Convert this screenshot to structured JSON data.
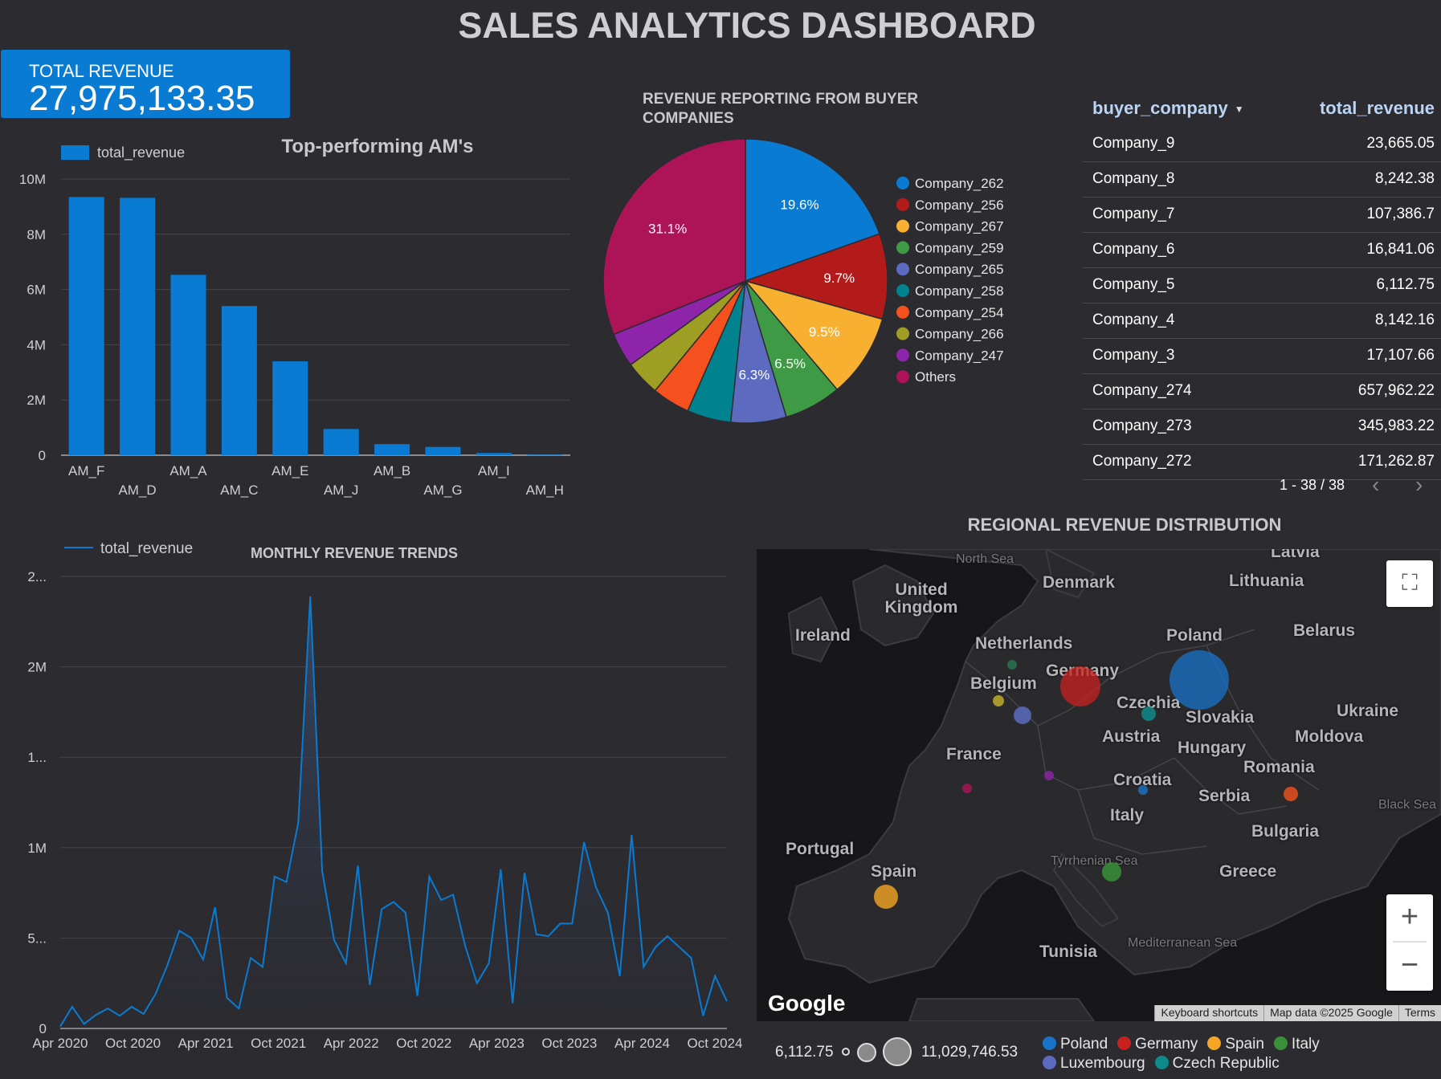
{
  "header": {
    "title": "SALES ANALYTICS DASHBOARD"
  },
  "kpi": {
    "label": "TOTAL REVENUE",
    "value": "27,975,133.35"
  },
  "am_chart": {
    "title": "Top-performing AM's",
    "legend": "total_revenue",
    "color": "#0a7bd3"
  },
  "pie_chart": {
    "title_line1": "REVENUE REPORTING FROM BUYER",
    "title_line2": "COMPANIES"
  },
  "table": {
    "col1": "buyer_company",
    "col2": "total_revenue",
    "rows": [
      {
        "company": "Company_9",
        "revenue": "23,665.05"
      },
      {
        "company": "Company_8",
        "revenue": "8,242.38"
      },
      {
        "company": "Company_7",
        "revenue": "107,386.7"
      },
      {
        "company": "Company_6",
        "revenue": "16,841.06"
      },
      {
        "company": "Company_5",
        "revenue": "6,112.75"
      },
      {
        "company": "Company_4",
        "revenue": "8,142.16"
      },
      {
        "company": "Company_3",
        "revenue": "17,107.66"
      },
      {
        "company": "Company_274",
        "revenue": "657,962.22"
      },
      {
        "company": "Company_273",
        "revenue": "345,983.22"
      },
      {
        "company": "Company_272",
        "revenue": "171,262.87"
      }
    ],
    "pagination": "1 - 38 / 38"
  },
  "trend_chart": {
    "title": "MONTHLY REVENUE TRENDS",
    "legend": "total_revenue"
  },
  "map": {
    "title": "REGIONAL REVENUE DISTRIBUTION",
    "country_labels": [
      "United Kingdom",
      "Ireland",
      "Denmark",
      "Lithuania",
      "Latvia",
      "Belarus",
      "Netherlands",
      "Germany",
      "Poland",
      "Belgium",
      "Czechia",
      "Slovakia",
      "Ukraine",
      "Austria",
      "Hungary",
      "Moldova",
      "France",
      "Romania",
      "Croatia",
      "Serbia",
      "Italy",
      "Bulgaria",
      "Portugal",
      "Spain",
      "Greece",
      "Tunisia"
    ],
    "sea_labels": [
      "North Sea",
      "Black Sea",
      "Tyrrhenian Sea",
      "Mediterranean Sea"
    ],
    "google_logo": "Google",
    "footer": [
      "Keyboard shortcuts",
      "Map data ©2025 Google",
      "Terms"
    ],
    "size_min": "6,112.75",
    "size_max": "11,029,746.53",
    "legend": [
      {
        "name": "Poland",
        "color": "#1a73c8"
      },
      {
        "name": "Germany",
        "color": "#c8201f"
      },
      {
        "name": "Spain",
        "color": "#f5a623"
      },
      {
        "name": "Italy",
        "color": "#3a8f3a"
      },
      {
        "name": "Luxembourg",
        "color": "#5b6bc0"
      },
      {
        "name": "Czech Republic",
        "color": "#0f8a8a"
      }
    ]
  },
  "chart_data": [
    {
      "type": "bar",
      "title": "Top-performing AM's",
      "categories": [
        "AM_F",
        "AM_D",
        "AM_A",
        "AM_C",
        "AM_E",
        "AM_J",
        "AM_B",
        "AM_G",
        "AM_I",
        "AM_H"
      ],
      "series": [
        {
          "name": "total_revenue",
          "values": [
            9350000,
            9320000,
            6530000,
            5400000,
            3400000,
            950000,
            400000,
            300000,
            80000,
            20000
          ]
        }
      ],
      "ylim": [
        0,
        10000000
      ],
      "yticks": [
        "0",
        "2M",
        "4M",
        "6M",
        "8M",
        "10M"
      ],
      "legend": "top-left",
      "grid": true
    },
    {
      "type": "pie",
      "title": "REVENUE REPORTING FROM BUYER COMPANIES",
      "labels": [
        "Company_262",
        "Company_256",
        "Company_267",
        "Company_259",
        "Company_265",
        "Company_258",
        "Company_254",
        "Company_266",
        "Company_247",
        "Others"
      ],
      "values": [
        19.6,
        9.7,
        9.5,
        6.5,
        6.3,
        5.0,
        4.3,
        4.0,
        3.9,
        31.1
      ],
      "colors": [
        "#0a7bd3",
        "#b31b1b",
        "#f8b030",
        "#3e9a45",
        "#5c6bc0",
        "#00838f",
        "#f4511e",
        "#9e9d24",
        "#8e24aa",
        "#ad1457"
      ],
      "data_labels": [
        "19.6%",
        "9.7%",
        "9.5%",
        "6.5%",
        "6.3%",
        "",
        "",
        "",
        "",
        "31.1%"
      ],
      "legend": "right"
    },
    {
      "type": "area",
      "title": "MONTHLY REVENUE TRENDS",
      "x_ticks": [
        "Apr 2020",
        "Oct 2020",
        "Apr 2021",
        "Oct 2021",
        "Apr 2022",
        "Oct 2022",
        "Apr 2023",
        "Oct 2023",
        "Apr 2024",
        "Oct 2024"
      ],
      "y_ticks": [
        "0",
        "5...",
        "1M",
        "1...",
        "2M",
        "2..."
      ],
      "ylim": [
        0,
        2500000
      ],
      "series": [
        {
          "name": "total_revenue",
          "values": [
            10000,
            120000,
            25000,
            75000,
            110000,
            70000,
            120000,
            80000,
            190000,
            350000,
            540000,
            500000,
            380000,
            670000,
            170000,
            110000,
            390000,
            340000,
            840000,
            810000,
            1140000,
            2390000,
            870000,
            490000,
            360000,
            900000,
            240000,
            660000,
            700000,
            640000,
            180000,
            840000,
            710000,
            740000,
            460000,
            250000,
            360000,
            880000,
            140000,
            860000,
            520000,
            510000,
            580000,
            580000,
            1030000,
            780000,
            640000,
            290000,
            1070000,
            340000,
            450000,
            510000,
            450000,
            390000,
            70000,
            290000,
            150000
          ]
        }
      ],
      "legend": "top-left",
      "grid": true
    }
  ]
}
